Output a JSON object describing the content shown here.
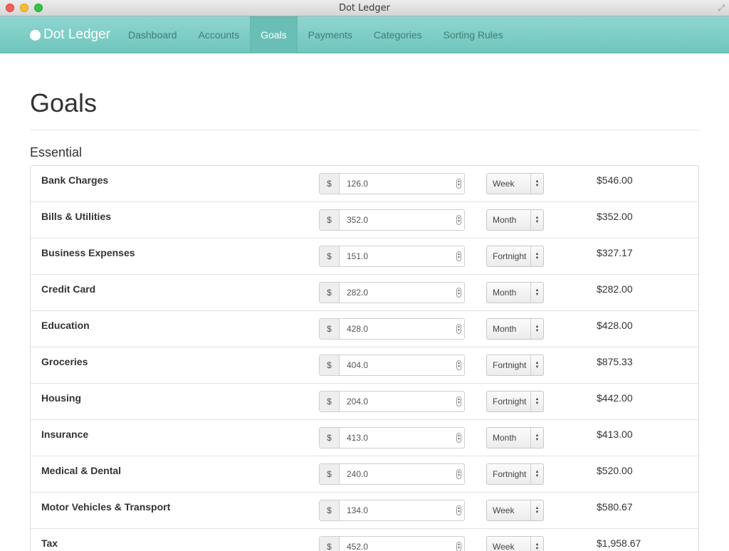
{
  "window": {
    "title": "Dot Ledger"
  },
  "navbar": {
    "brand": "Dot Ledger",
    "items": [
      {
        "label": "Dashboard",
        "active": false
      },
      {
        "label": "Accounts",
        "active": false
      },
      {
        "label": "Goals",
        "active": true
      },
      {
        "label": "Payments",
        "active": false
      },
      {
        "label": "Categories",
        "active": false
      },
      {
        "label": "Sorting Rules",
        "active": false
      }
    ]
  },
  "page": {
    "title": "Goals",
    "section": "Essential"
  },
  "currency_symbol": "$",
  "goals": [
    {
      "name": "Bank Charges",
      "amount": "126.0",
      "period": "Week",
      "total": "$546.00"
    },
    {
      "name": "Bills & Utilities",
      "amount": "352.0",
      "period": "Month",
      "total": "$352.00"
    },
    {
      "name": "Business Expenses",
      "amount": "151.0",
      "period": "Fortnight",
      "total": "$327.17"
    },
    {
      "name": "Credit Card",
      "amount": "282.0",
      "period": "Month",
      "total": "$282.00"
    },
    {
      "name": "Education",
      "amount": "428.0",
      "period": "Month",
      "total": "$428.00"
    },
    {
      "name": "Groceries",
      "amount": "404.0",
      "period": "Fortnight",
      "total": "$875.33"
    },
    {
      "name": "Housing",
      "amount": "204.0",
      "period": "Fortnight",
      "total": "$442.00"
    },
    {
      "name": "Insurance",
      "amount": "413.0",
      "period": "Month",
      "total": "$413.00"
    },
    {
      "name": "Medical & Dental",
      "amount": "240.0",
      "period": "Fortnight",
      "total": "$520.00"
    },
    {
      "name": "Motor Vehicles & Transport",
      "amount": "134.0",
      "period": "Week",
      "total": "$580.67"
    },
    {
      "name": "Tax",
      "amount": "452.0",
      "period": "Week",
      "total": "$1,958.67"
    }
  ],
  "colors": {
    "navbar": "#7ccdc5",
    "nav_active": "#69bfb6",
    "nav_text": "#3f7d77"
  }
}
